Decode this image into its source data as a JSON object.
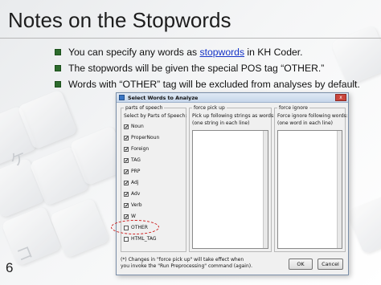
{
  "slide": {
    "title": "Notes on the Stopwords",
    "page_number": "6",
    "bullets": [
      {
        "before": "You can specify any words as ",
        "link": "stopwords",
        "after": " in KH Coder."
      },
      {
        "text": "The stopwords will be given the special POS tag “OTHER.”"
      },
      {
        "text": "Words with “OTHER” tag will be excluded from analyses by default."
      }
    ],
    "background_glyphs": [
      "ケ",
      "コ"
    ]
  },
  "dialog": {
    "title": "Select Words to Analyze",
    "close_label": "x",
    "pos_group": {
      "legend": "parts of speech",
      "subtitle": "Select by Parts of Speech:",
      "items": [
        {
          "label": "Noun",
          "checked": true,
          "mark": "✔"
        },
        {
          "label": "ProperNoun",
          "checked": true,
          "mark": "✔"
        },
        {
          "label": "Foreign",
          "checked": true,
          "mark": "✔"
        },
        {
          "label": "TAG",
          "checked": true,
          "mark": "✔"
        },
        {
          "label": "PRP",
          "checked": true,
          "mark": "✔"
        },
        {
          "label": "Adj",
          "checked": true,
          "mark": "✔"
        },
        {
          "label": "Adv",
          "checked": true,
          "mark": "✔"
        },
        {
          "label": "Verb",
          "checked": true,
          "mark": "✔"
        },
        {
          "label": "W",
          "checked": true,
          "mark": "✔"
        },
        {
          "label": "OTHER",
          "checked": false,
          "mark": ""
        },
        {
          "label": "HTML_TAG",
          "checked": false,
          "mark": ""
        }
      ]
    },
    "pick_group": {
      "legend": "force pick up",
      "line1": "Pick up following strings as words:",
      "line2": "(one string in each line)",
      "value": ""
    },
    "ignore_group": {
      "legend": "force ignore",
      "line1": "Force ignore following words:",
      "line2": "(one word in each line)",
      "value": ""
    },
    "note_line1": "(*) Changes in \"force pick up\" will take effect when",
    "note_line2": "you invoke the \"Run Preprocessing\" command (again).",
    "ok_label": "OK",
    "cancel_label": "Cancel"
  },
  "colors": {
    "bullet_square": "#2d6b2d",
    "link": "#1533c7",
    "highlight_ring": "#cc1f1f",
    "dialog_border": "#7a8ea8"
  }
}
